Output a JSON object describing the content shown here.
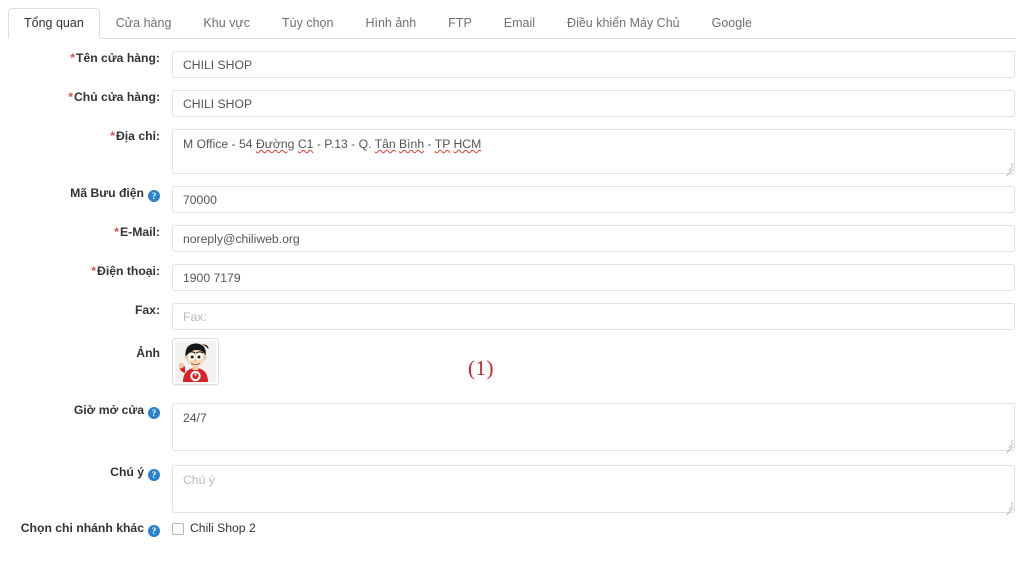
{
  "tabs": [
    {
      "label": "Tổng quan",
      "active": true
    },
    {
      "label": "Cửa hàng",
      "active": false
    },
    {
      "label": "Khu vực",
      "active": false
    },
    {
      "label": "Tùy chọn",
      "active": false
    },
    {
      "label": "Hình ảnh",
      "active": false
    },
    {
      "label": "FTP",
      "active": false
    },
    {
      "label": "Email",
      "active": false
    },
    {
      "label": "Điều khiển Máy Chủ",
      "active": false
    },
    {
      "label": "Google",
      "active": false
    }
  ],
  "form": {
    "store_name": {
      "label": "Tên cửa hàng:",
      "required_marker": "*",
      "value": "CHILI SHOP",
      "placeholder": "Tên cửa hàng"
    },
    "store_owner": {
      "label": "Chủ cửa hàng:",
      "required_marker": "*",
      "value": "CHILI SHOP",
      "placeholder": "Chủ cửa hàng"
    },
    "address": {
      "label": "Địa chỉ:",
      "required_marker": "*",
      "value": "M Office - 54 Đường C1 - P.13 - Q. Tân Bình - TP HCM",
      "placeholder": "Địa chỉ",
      "segments": [
        {
          "text": "M Office - 54 ",
          "misspelled": false
        },
        {
          "text": "Đường",
          "misspelled": true
        },
        {
          "text": " ",
          "misspelled": false
        },
        {
          "text": "C1",
          "misspelled": true
        },
        {
          "text": " - P.13 - Q. ",
          "misspelled": false
        },
        {
          "text": "Tân",
          "misspelled": true
        },
        {
          "text": " ",
          "misspelled": false
        },
        {
          "text": "Bình",
          "misspelled": true
        },
        {
          "text": " - ",
          "misspelled": false
        },
        {
          "text": "TP",
          "misspelled": true
        },
        {
          "text": " ",
          "misspelled": false
        },
        {
          "text": "HCM",
          "misspelled": true
        }
      ]
    },
    "postcode": {
      "label": "Mã Bưu điện",
      "help": "?",
      "value": "70000",
      "placeholder": "Mã Bưu điện"
    },
    "email": {
      "label": "E-Mail:",
      "required_marker": "*",
      "value": "noreply@chiliweb.org",
      "placeholder": "E-Mail"
    },
    "phone": {
      "label": "Điện thoại:",
      "required_marker": "*",
      "value": "1900 7179",
      "placeholder": "Điện thoại"
    },
    "fax": {
      "label": "Fax:",
      "value": "",
      "placeholder": "Fax:"
    },
    "photo": {
      "label": "Ảnh",
      "alt": "store-avatar"
    },
    "opening_hours": {
      "label": "Giờ mở cửa",
      "help": "?",
      "value": "24/7",
      "placeholder": "Giờ mở cửa"
    },
    "note": {
      "label": "Chú ý",
      "help": "?",
      "value": "",
      "placeholder": "Chú ý"
    },
    "other_branch": {
      "label": "Chọn chi nhánh khác",
      "help": "?",
      "checkbox_label": "Chili Shop 2",
      "checked": false
    }
  },
  "annotation": {
    "text": "(1)",
    "color": "#cc2229"
  },
  "colors": {
    "required_star": "#d9534f",
    "help_icon": "#2a82c8",
    "border": "#e0e0e0",
    "tab_border": "#dddddd",
    "text": "#333333",
    "placeholder": "#bbbbbb",
    "spellcheck_underline": "#e03b2f"
  }
}
